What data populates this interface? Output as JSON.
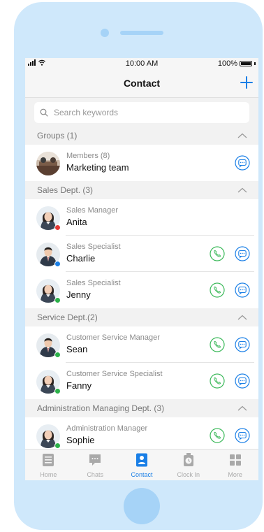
{
  "status_bar": {
    "time": "10:00 AM",
    "battery": "100%"
  },
  "header": {
    "title": "Contact"
  },
  "search": {
    "placeholder": "Search keywords"
  },
  "colors": {
    "accent": "#1a7fe6",
    "call_green": "#3cb95a",
    "online": "#2cb14a",
    "busy": "#e53935",
    "away": "#1a7fe6"
  },
  "sections": [
    {
      "title": "Groups (1)",
      "rows": [
        {
          "subtitle": "Members (8)",
          "name": "Marketing team",
          "avatar": "group-photo",
          "call": false,
          "message": true
        }
      ]
    },
    {
      "title": "Sales Dept. (3)",
      "rows": [
        {
          "subtitle": "Sales Manager",
          "name": "Anita",
          "avatar": "woman-photo",
          "status": "busy",
          "call": false,
          "message": false
        },
        {
          "subtitle": "Sales Specialist",
          "name": "Charlie",
          "avatar": "man-photo",
          "status": "away",
          "call": true,
          "message": true
        },
        {
          "subtitle": "Sales Specialist",
          "name": "Jenny",
          "avatar": "woman-photo",
          "status": "online",
          "call": true,
          "message": true
        }
      ]
    },
    {
      "title": "Service Dept.(2)",
      "rows": [
        {
          "subtitle": "Customer Service Manager",
          "name": "Sean",
          "avatar": "man-photo",
          "status": "online",
          "call": true,
          "message": true
        },
        {
          "subtitle": "Customer Service Specialist",
          "name": "Fanny",
          "avatar": "woman-photo",
          "status": "online",
          "call": true,
          "message": true
        }
      ]
    },
    {
      "title": "Administration Managing Dept. (3)",
      "rows": [
        {
          "subtitle": "Administration Manager",
          "name": "Sophie",
          "avatar": "woman-photo",
          "status": "online",
          "call": true,
          "message": true
        }
      ]
    }
  ],
  "tabs": [
    {
      "label": "Home",
      "icon": "home-icon",
      "active": false
    },
    {
      "label": "Chats",
      "icon": "chat-icon",
      "active": false
    },
    {
      "label": "Contact",
      "icon": "contact-icon",
      "active": true
    },
    {
      "label": "Clock In",
      "icon": "clock-icon",
      "active": false
    },
    {
      "label": "More",
      "icon": "grid-icon",
      "active": false
    }
  ]
}
